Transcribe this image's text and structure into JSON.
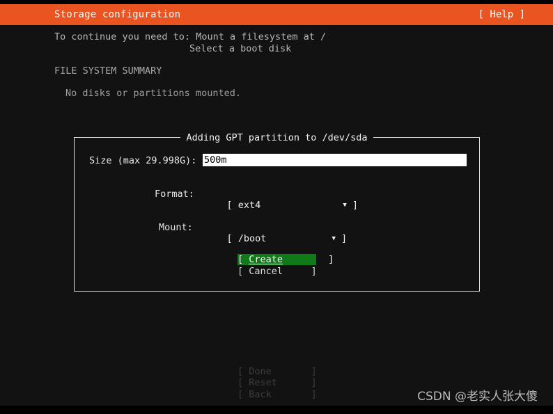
{
  "header": {
    "title": "Storage configuration",
    "help_label": "[ Help ]"
  },
  "body": {
    "continue_line_1": "To continue you need to: Mount a filesystem at /",
    "continue_line_2": "Select a boot disk",
    "summary_heading": "FILE SYSTEM SUMMARY",
    "summary_body": "No disks or partitions mounted."
  },
  "dialog": {
    "title": "Adding GPT partition to /dev/sda",
    "size": {
      "label": "Size (max 29.998G):",
      "value": "500m",
      "placeholder": ""
    },
    "format": {
      "label": "Format:",
      "open_bracket": "[",
      "value": "ext4",
      "arrow": "▼",
      "close_bracket": "]"
    },
    "mount": {
      "label": "Mount:",
      "open_bracket": "[",
      "value": "/boot",
      "arrow": "▼",
      "close_bracket": "]"
    },
    "buttons": {
      "create_open": "[ ",
      "create_label": "Create",
      "create_close": "        ]",
      "cancel": "[ Cancel     ]"
    }
  },
  "footer": {
    "done": "[ Done       ]",
    "reset": "[ Reset      ]",
    "back": "[ Back       ]"
  },
  "watermark": {
    "text": "CSDN @老实人张大傻"
  },
  "colors": {
    "accent_orange": "#e95420",
    "highlight_green": "#0f7a17",
    "background": "#121212",
    "text": "#cfcfcf",
    "input_background": "#ffffff",
    "disabled_text": "#3c3c3c"
  }
}
